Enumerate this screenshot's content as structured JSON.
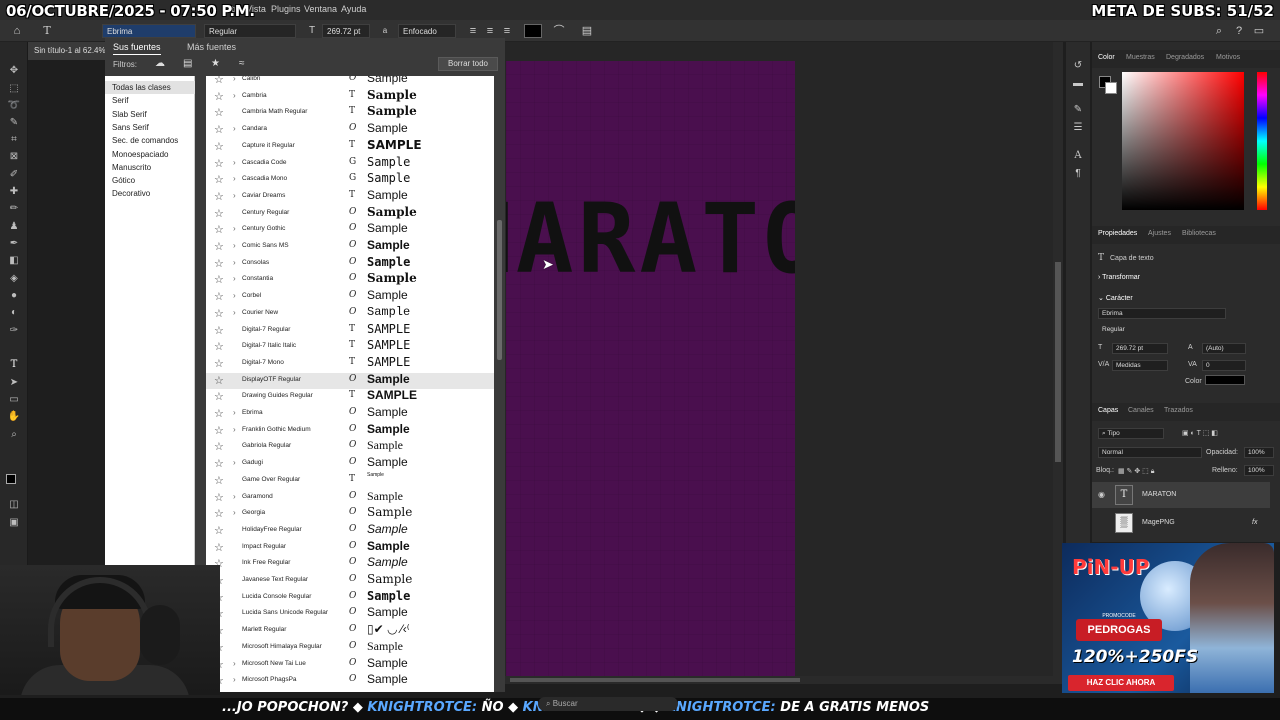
{
  "overlay": {
    "date": "06/OCTUBRE/2025 - 07:50 P.M.",
    "goal": "META DE SUBS: 51/52"
  },
  "menubar": {
    "items": [
      "Filtro",
      "Vista",
      "Plugins",
      "Ventana",
      "Ayuda"
    ]
  },
  "optionsbar": {
    "font_family": "Ebrima",
    "font_style": "Regular",
    "font_size": "269.72 pt",
    "antialias": "Enfocado",
    "color": "#000000"
  },
  "document": {
    "tab": "Sin título-1 al 62.4%"
  },
  "font_panel": {
    "tab_active": "Sus fuentes",
    "tab_other": "Más fuentes",
    "filters_label": "Filtros:",
    "clear_all": "Borrar todo",
    "classes": [
      "Todas las clases",
      "Serif",
      "Slab Serif",
      "Sans Serif",
      "Sec. de comandos",
      "Monoespaciado",
      "Manuscrito",
      "Gótico",
      "Decorativo"
    ],
    "selected_font": "DisplayOTF Regular",
    "fonts": [
      {
        "name": "Calibri",
        "type": "O",
        "sample": "Sample",
        "expand": true
      },
      {
        "name": "Cambria",
        "type": "T",
        "sample": "Sample",
        "expand": true
      },
      {
        "name": "Cambria Math Regular",
        "type": "T",
        "sample": "Sample",
        "expand": false
      },
      {
        "name": "Candara",
        "type": "O",
        "sample": "Sample",
        "expand": true
      },
      {
        "name": "Capture it Regular",
        "type": "T",
        "sample": "SAMPLE",
        "expand": false
      },
      {
        "name": "Cascadia Code",
        "type": "G",
        "sample": "Sample",
        "expand": true
      },
      {
        "name": "Cascadia Mono",
        "type": "G",
        "sample": "Sample",
        "expand": true
      },
      {
        "name": "Caviar Dreams",
        "type": "T",
        "sample": "Sample",
        "expand": true
      },
      {
        "name": "Century Regular",
        "type": "O",
        "sample": "Sample",
        "expand": false
      },
      {
        "name": "Century Gothic",
        "type": "O",
        "sample": "Sample",
        "expand": true
      },
      {
        "name": "Comic Sans MS",
        "type": "O",
        "sample": "Sample",
        "expand": true
      },
      {
        "name": "Consolas",
        "type": "O",
        "sample": "Sample",
        "expand": true
      },
      {
        "name": "Constantia",
        "type": "O",
        "sample": "Sample",
        "expand": true
      },
      {
        "name": "Corbel",
        "type": "O",
        "sample": "Sample",
        "expand": true
      },
      {
        "name": "Courier New",
        "type": "O",
        "sample": "Sample",
        "expand": true
      },
      {
        "name": "Digital-7 Regular",
        "type": "T",
        "sample": "SAMPLE",
        "expand": false
      },
      {
        "name": "Digital-7 Italic Italic",
        "type": "T",
        "sample": "SAMPLE",
        "expand": false
      },
      {
        "name": "Digital-7 Mono",
        "type": "T",
        "sample": "SAMPLE",
        "expand": false
      },
      {
        "name": "DisplayOTF Regular",
        "type": "O",
        "sample": "Sample",
        "expand": false
      },
      {
        "name": "Drawing Guides Regular",
        "type": "T",
        "sample": "SAMPLE",
        "expand": false
      },
      {
        "name": "Ebrima",
        "type": "O",
        "sample": "Sample",
        "expand": true
      },
      {
        "name": "Franklin Gothic Medium",
        "type": "O",
        "sample": "Sample",
        "expand": true
      },
      {
        "name": "Gabriola Regular",
        "type": "O",
        "sample": "Sample",
        "expand": false
      },
      {
        "name": "Gadugi",
        "type": "O",
        "sample": "Sample",
        "expand": true
      },
      {
        "name": "Game Over Regular",
        "type": "T",
        "sample": "Sample",
        "expand": false
      },
      {
        "name": "Garamond",
        "type": "O",
        "sample": "Sample",
        "expand": true
      },
      {
        "name": "Georgia",
        "type": "O",
        "sample": "Sample",
        "expand": true
      },
      {
        "name": "HolidayFree Regular",
        "type": "O",
        "sample": "Sample",
        "expand": false
      },
      {
        "name": "Impact Regular",
        "type": "O",
        "sample": "Sample",
        "expand": false
      },
      {
        "name": "Ink Free Regular",
        "type": "O",
        "sample": "Sample",
        "expand": false
      },
      {
        "name": "Javanese Text Regular",
        "type": "O",
        "sample": "Sample",
        "expand": false
      },
      {
        "name": "Lucida Console Regular",
        "type": "O",
        "sample": "Sample",
        "expand": false
      },
      {
        "name": "Lucida Sans Unicode Regular",
        "type": "O",
        "sample": "Sample",
        "expand": false
      },
      {
        "name": "Marlett Regular",
        "type": "O",
        "sample": "▯✔ ◡ ⁄‹⁽",
        "expand": false
      },
      {
        "name": "Microsoft Himalaya Regular",
        "type": "O",
        "sample": "Sample",
        "expand": false
      },
      {
        "name": "Microsoft New Tai Lue",
        "type": "O",
        "sample": "Sample",
        "expand": true
      },
      {
        "name": "Microsoft PhagsPa",
        "type": "O",
        "sample": "Sample",
        "expand": true
      }
    ]
  },
  "canvas": {
    "text": "MARATON",
    "background": "#4a0f4e"
  },
  "color_panel": {
    "tabs": [
      "Color",
      "Muestras",
      "Degradados",
      "Motivos"
    ]
  },
  "properties_panel": {
    "tabs": [
      "Propiedades",
      "Ajustes",
      "Bibliotecas"
    ],
    "layer_type": "Capa de texto",
    "transform": "Transformar",
    "character": "Carácter",
    "font_family": "Ebrima",
    "font_style": "Regular",
    "font_size": "269.72 pt",
    "leading": "(Auto)",
    "kerning": "Medidas",
    "tracking": "0",
    "color_label": "Color"
  },
  "layers_panel": {
    "tabs": [
      "Capas",
      "Canales",
      "Trazados"
    ],
    "filter": "Tipo",
    "blend_mode": "Normal",
    "opacity_label": "Opacidad:",
    "opacity": "100%",
    "lock_label": "Bloq.:",
    "fill_label": "Relleno:",
    "fill": "100%",
    "layers": [
      {
        "name": "MARATON",
        "kind": "T"
      },
      {
        "name": "MagePNG",
        "kind": "img"
      }
    ]
  },
  "ad": {
    "logo": "PiN-UP",
    "promo_label": "PROMOCODE",
    "promo_code": "PEDROGAS",
    "bonus": "120%+250FS",
    "cta": "HAZ CLIC AHORA"
  },
  "ticker": {
    "segments": [
      {
        "user": "",
        "text": "...JO POPOCHON?"
      },
      {
        "user": "KNIGHTROTCE:",
        "text": "ÑO"
      },
      {
        "user": "KNIGHTROTCE:",
        "text": ""
      },
      {
        "user": "KNIGHTROTCE:",
        "text": "DE A GRATIS MENOS"
      }
    ]
  },
  "taskbar": {
    "search_placeholder": "Buscar"
  }
}
